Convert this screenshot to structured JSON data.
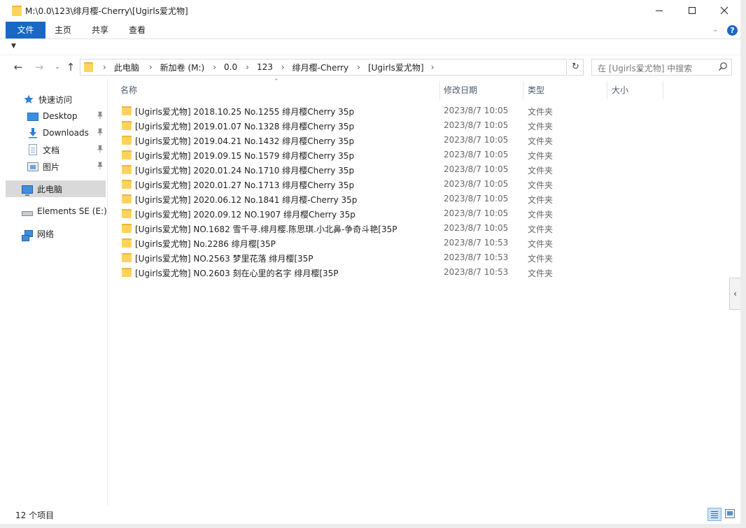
{
  "window": {
    "title": "M:\\0.0\\123\\绯月樱-Cherry\\[Ugirls爱尤物]"
  },
  "ribbon": {
    "tabs": [
      {
        "label": "文件"
      },
      {
        "label": "主页"
      },
      {
        "label": "共享"
      },
      {
        "label": "查看"
      }
    ]
  },
  "address": {
    "crumbs": [
      "此电脑",
      "新加卷 (M:)",
      "0.0",
      "123",
      "绯月樱-Cherry",
      "[Ugirls爱尤物]"
    ]
  },
  "search": {
    "placeholder": "在 [Ugirls爱尤物] 中搜索"
  },
  "sidebar": {
    "items": [
      {
        "label": "快速访问",
        "icon": "star-icon"
      },
      {
        "label": "Desktop",
        "icon": "desktop-icon",
        "pinned": true
      },
      {
        "label": "Downloads",
        "icon": "downloads-icon",
        "pinned": true
      },
      {
        "label": "文档",
        "icon": "documents-icon",
        "pinned": true
      },
      {
        "label": "图片",
        "icon": "pictures-icon",
        "pinned": true
      },
      {
        "label": "此电脑",
        "icon": "this-pc-icon",
        "selected": true
      },
      {
        "label": "Elements SE (E:)",
        "icon": "drive-icon"
      },
      {
        "label": "网络",
        "icon": "network-icon"
      }
    ]
  },
  "columns": {
    "name": "名称",
    "date": "修改日期",
    "type": "类型",
    "size": "大小"
  },
  "files": [
    {
      "name": "[Ugirls爱尤物] 2018.10.25 No.1255 绯月樱Cherry 35p",
      "date": "2023/8/7 10:05",
      "type": "文件夹"
    },
    {
      "name": "[Ugirls爱尤物] 2019.01.07 No.1328 绯月樱Cherry 35p",
      "date": "2023/8/7 10:05",
      "type": "文件夹"
    },
    {
      "name": "[Ugirls爱尤物] 2019.04.21 No.1432 绯月樱Cherry 35p",
      "date": "2023/8/7 10:05",
      "type": "文件夹"
    },
    {
      "name": "[Ugirls爱尤物] 2019.09.15 No.1579 绯月樱Cherry 35p",
      "date": "2023/8/7 10:05",
      "type": "文件夹"
    },
    {
      "name": "[Ugirls爱尤物] 2020.01.24 No.1710 绯月樱Cherry 35p",
      "date": "2023/8/7 10:05",
      "type": "文件夹"
    },
    {
      "name": "[Ugirls爱尤物] 2020.01.27 No.1713 绯月樱Cherry 35p",
      "date": "2023/8/7 10:05",
      "type": "文件夹"
    },
    {
      "name": "[Ugirls爱尤物] 2020.06.12 No.1841 绯月樱-Cherry 35p",
      "date": "2023/8/7 10:05",
      "type": "文件夹"
    },
    {
      "name": "[Ugirls爱尤物] 2020.09.12 NO.1907 绯月樱Cherry 35p",
      "date": "2023/8/7 10:05",
      "type": "文件夹"
    },
    {
      "name": "[Ugirls爱尤物] NO.1682 雪千寻.绯月樱.陈思琪.小北鼻-争奇斗艳[35P",
      "date": "2023/8/7 10:05",
      "type": "文件夹"
    },
    {
      "name": "[Ugirls爱尤物] No.2286 绯月樱[35P",
      "date": "2023/8/7 10:53",
      "type": "文件夹"
    },
    {
      "name": "[Ugirls爱尤物] NO.2563 梦里花落 绯月樱[35P",
      "date": "2023/8/7 10:53",
      "type": "文件夹"
    },
    {
      "name": "[Ugirls爱尤物] NO.2603 刻在心里的名字 绯月樱[35P",
      "date": "2023/8/7 10:53",
      "type": "文件夹"
    }
  ],
  "status": {
    "item_count": "12 个项目"
  },
  "colors": {
    "accent": "#1a68c4",
    "folder": "#ffd35c",
    "selection": "#d9d9d9"
  }
}
